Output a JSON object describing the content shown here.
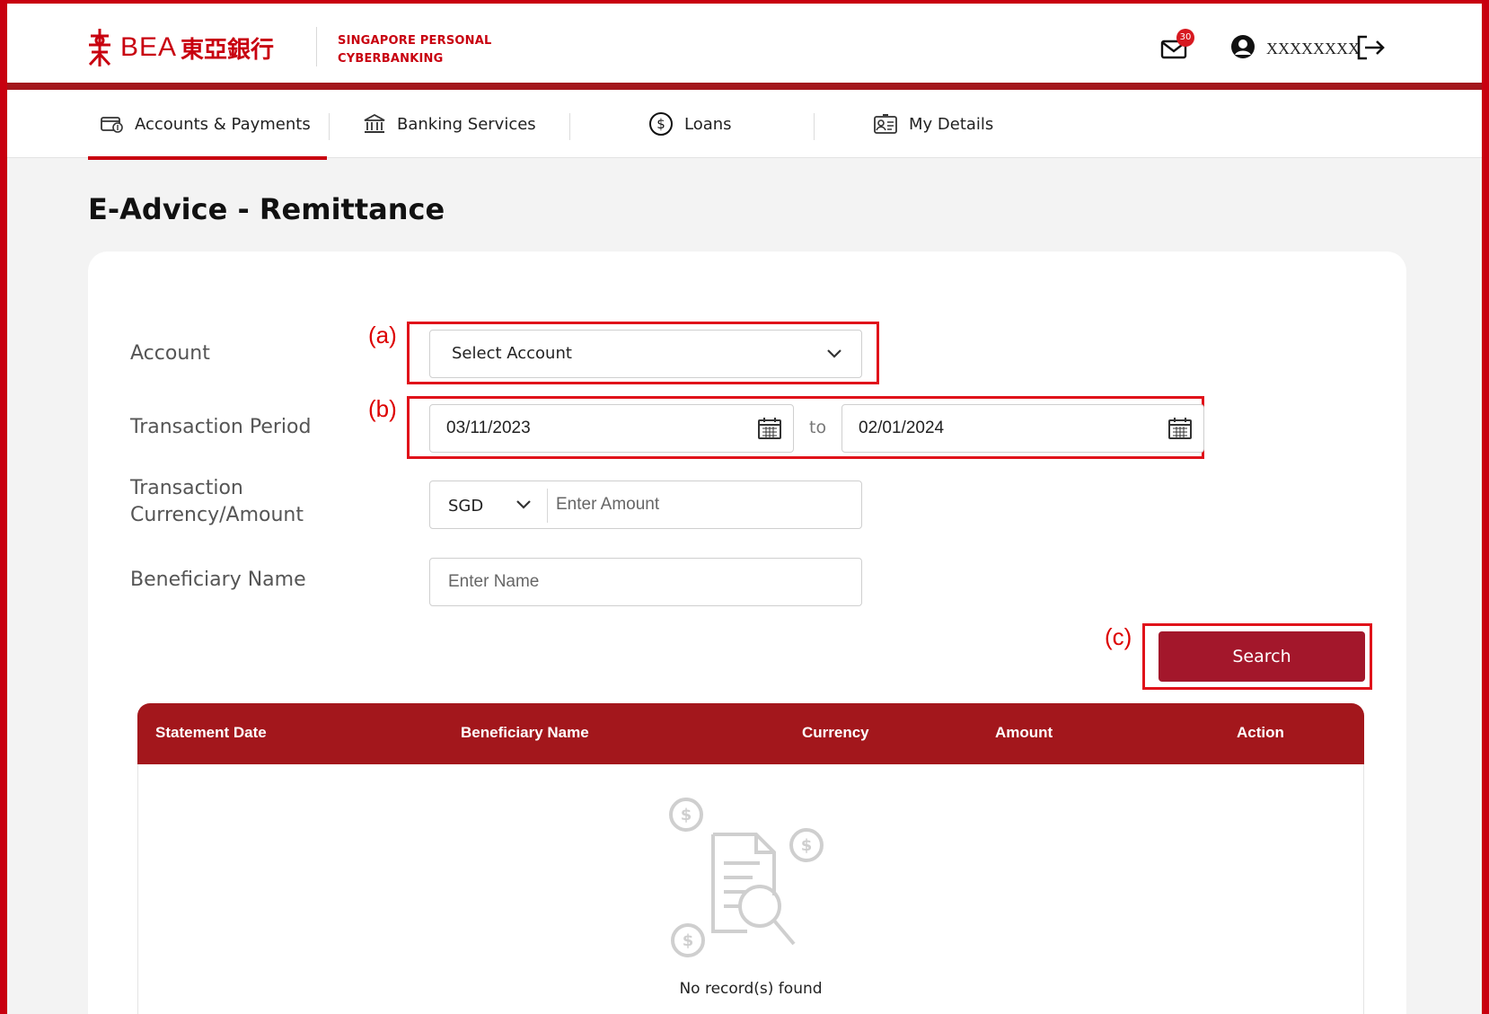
{
  "brand": {
    "name": "BEA",
    "name_cjk": "東亞銀行",
    "subtitle_line1": "SINGAPORE PERSONAL",
    "subtitle_line2": "CYBERBANKING",
    "accent_color": "#c8000f",
    "dark_red": "#a3171c"
  },
  "header": {
    "mail_icon": "mail-icon",
    "mail_count": "30",
    "user_icon": "user-icon",
    "username": "XXXXXXXX",
    "logout_icon": "logout-icon"
  },
  "nav": {
    "items": [
      {
        "label": "Accounts & Payments",
        "icon": "wallet-icon",
        "active": true
      },
      {
        "label": "Banking Services",
        "icon": "bank-icon",
        "active": false
      },
      {
        "label": "Loans",
        "icon": "dollar-icon",
        "active": false
      },
      {
        "label": "My Details",
        "icon": "id-card-icon",
        "active": false
      }
    ]
  },
  "page": {
    "title": "E-Advice - Remittance"
  },
  "form": {
    "account_label": "Account",
    "account_value": "Select Account",
    "period_label": "Transaction Period",
    "period_from": "03/11/2023",
    "period_to_word": "to",
    "period_to": "02/01/2024",
    "currency_label_line1": "Transaction",
    "currency_label_line2": "Currency/Amount",
    "currency_value": "SGD",
    "amount_placeholder": "Enter Amount",
    "beneficiary_label": "Beneficiary Name",
    "beneficiary_placeholder": "Enter Name",
    "search_label": "Search"
  },
  "annotations": {
    "a": "(a)",
    "b": "(b)",
    "c": "(c)"
  },
  "table": {
    "columns": [
      "Statement Date",
      "Beneficiary Name",
      "Currency",
      "Amount",
      "Action"
    ],
    "rows": [],
    "empty_text": "No record(s) found",
    "empty_icon": "no-records-search-icon"
  }
}
